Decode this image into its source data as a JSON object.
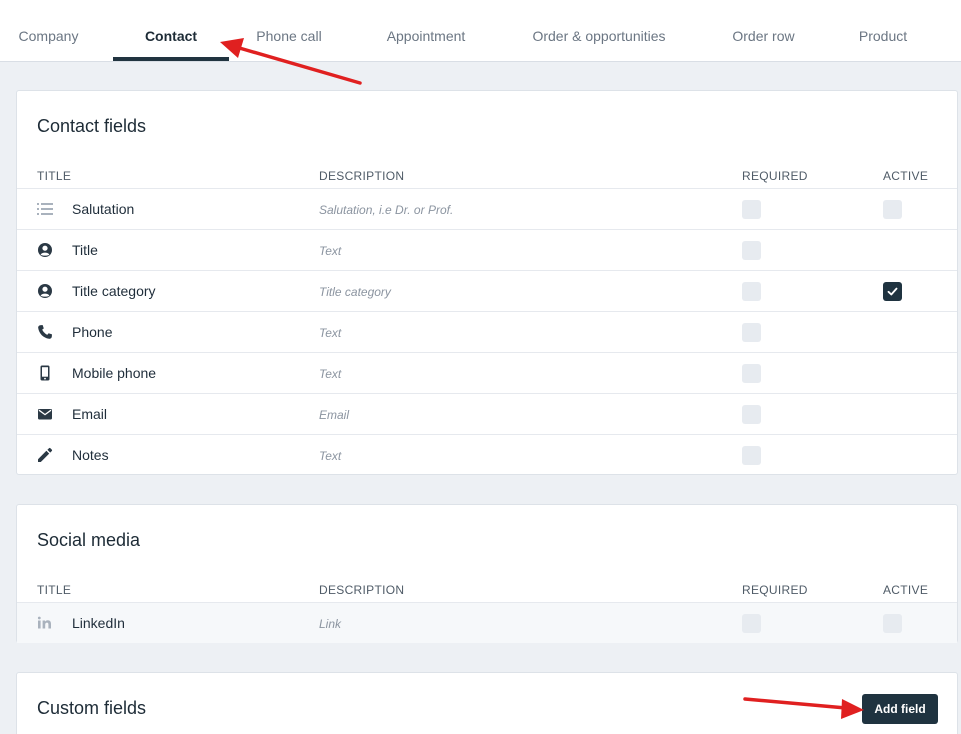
{
  "tabs": [
    {
      "label": "Company",
      "active": false
    },
    {
      "label": "Contact",
      "active": true
    },
    {
      "label": "Phone call",
      "active": false
    },
    {
      "label": "Appointment",
      "active": false
    },
    {
      "label": "Order & opportunities",
      "active": false
    },
    {
      "label": "Order row",
      "active": false
    },
    {
      "label": "Product",
      "active": false
    }
  ],
  "columns": {
    "title": "TITLE",
    "description": "DESCRIPTION",
    "required": "REQUIRED",
    "active": "ACTIVE"
  },
  "contact_fields": {
    "title": "Contact fields",
    "rows": [
      {
        "title": "Salutation",
        "description": "Salutation, i.e Dr. or Prof.",
        "icon": "list-icon",
        "required": false,
        "active": false,
        "active_shown": true
      },
      {
        "title": "Title",
        "description": "Text",
        "icon": "user-circle-icon",
        "required": false,
        "active_shown": false
      },
      {
        "title": "Title category",
        "description": "Title category",
        "icon": "user-circle-icon",
        "required": false,
        "active": true,
        "active_shown": true
      },
      {
        "title": "Phone",
        "description": "Text",
        "icon": "phone-icon",
        "required": false,
        "active_shown": false
      },
      {
        "title": "Mobile phone",
        "description": "Text",
        "icon": "mobile-phone-icon",
        "required": false,
        "active_shown": false
      },
      {
        "title": "Email",
        "description": "Email",
        "icon": "envelope-icon",
        "required": false,
        "active_shown": false
      },
      {
        "title": "Notes",
        "description": "Text",
        "icon": "pencil-icon",
        "required": false,
        "active_shown": false
      }
    ]
  },
  "social_media": {
    "title": "Social media",
    "rows": [
      {
        "title": "LinkedIn",
        "description": "Link",
        "icon": "linkedin-icon",
        "required": false,
        "active": false,
        "active_shown": true
      }
    ]
  },
  "custom_fields": {
    "title": "Custom fields",
    "add_button": "Add field"
  },
  "colors": {
    "accent": "#1f3340",
    "annotation_arrow": "#e02020"
  }
}
